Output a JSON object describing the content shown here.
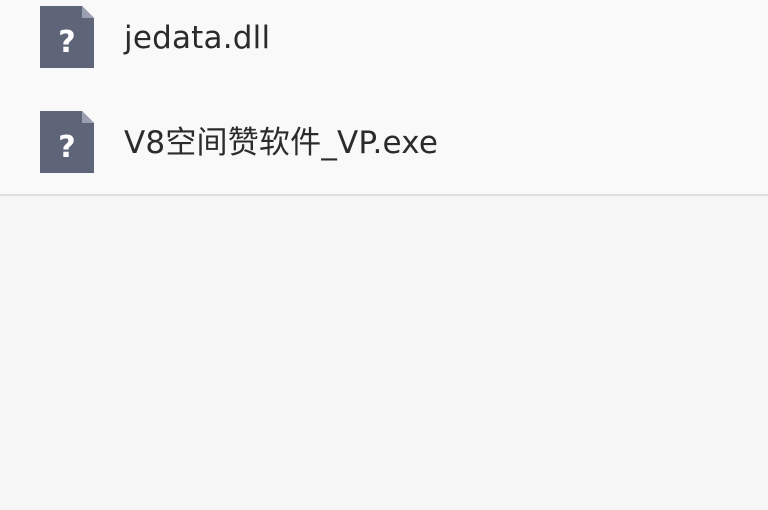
{
  "files": [
    {
      "name": "jedata.dll",
      "icon": "unknown-file-icon"
    },
    {
      "name": "V8空间赞软件_VP.exe",
      "icon": "unknown-file-icon"
    }
  ],
  "colors": {
    "icon_body": "#5f6578",
    "icon_glyph": "#ffffff",
    "text": "#2b2b2b",
    "background": "#f6f6f6"
  }
}
